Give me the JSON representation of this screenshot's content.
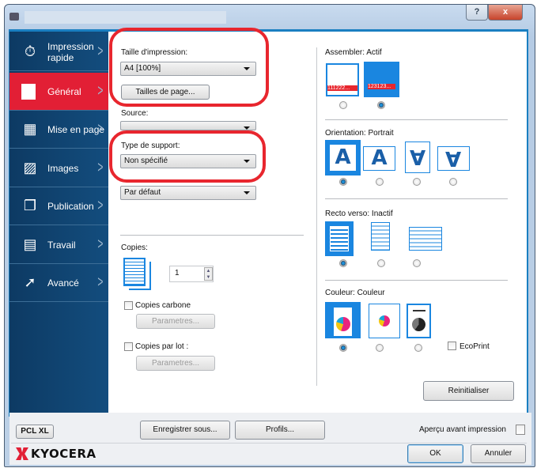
{
  "window": {
    "help": "?",
    "close": "x"
  },
  "sidebar": {
    "items": [
      {
        "label": "Impression rapide",
        "icon": "stopwatch-icon"
      },
      {
        "label": "Général",
        "icon": "page-icon",
        "active": true
      },
      {
        "label": "Mise en page",
        "icon": "layout-icon"
      },
      {
        "label": "Images",
        "icon": "image-icon"
      },
      {
        "label": "Publication",
        "icon": "publication-icon"
      },
      {
        "label": "Travail",
        "icon": "job-icon"
      },
      {
        "label": "Avancé",
        "icon": "arrow-icon"
      }
    ]
  },
  "general": {
    "print_size_label": "Taille d'impression:",
    "print_size_value": "A4  [100%]",
    "page_sizes_button": "Tailles de page...",
    "source_label": "Source:",
    "media_type_label": "Type de support:",
    "media_type_value": "Non spécifié",
    "default_select_value": "Par défaut",
    "copies_label": "Copies:",
    "copies_value": "1",
    "carbon_copies_label": "Copies carbone",
    "carbon_params_button": "Parametres...",
    "batch_copies_label": "Copies par lot :",
    "batch_params_button": "Parametres..."
  },
  "right": {
    "collate_label": "Assembler:  Actif",
    "collate_icons": [
      "111222...",
      "123123..."
    ],
    "orientation_label": "Orientation:  Portrait",
    "duplex_label": "Recto verso:  Inactif",
    "color_label": "Couleur:  Couleur",
    "ecoprint_label": "EcoPrint",
    "reset_button": "Reinitialiser"
  },
  "footer": {
    "pdl_button": "PCL XL",
    "save_as_button": "Enregistrer sous...",
    "profiles_button": "Profils...",
    "preview_label": "Aperçu avant impression",
    "logo": "KYOCERA",
    "ok_button": "OK",
    "cancel_button": "Annuler"
  },
  "colors": {
    "accent": "#1a86e0",
    "active_nav": "#e21f35",
    "highlight": "#e8262e",
    "sidebar": "#0d3a63"
  }
}
